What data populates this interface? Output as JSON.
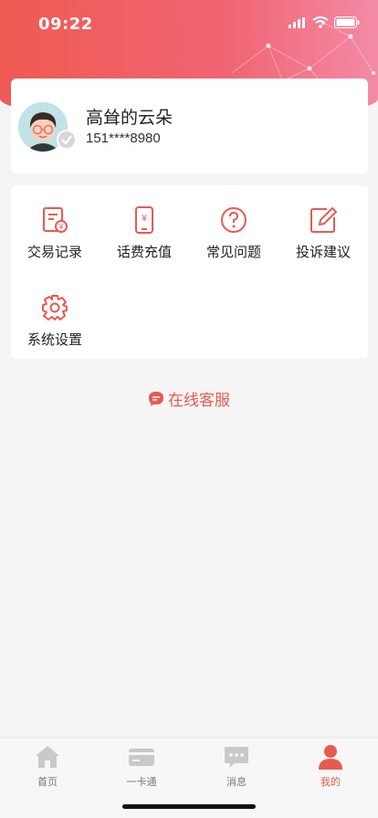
{
  "status": {
    "time": "09:22"
  },
  "profile": {
    "name": "高耸的云朵",
    "phone": "151****8980"
  },
  "menu": {
    "items": [
      {
        "label": "交易记录",
        "icon": "receipt-icon"
      },
      {
        "label": "话费充值",
        "icon": "phone-recharge-icon"
      },
      {
        "label": "常见问题",
        "icon": "question-icon"
      },
      {
        "label": "投诉建议",
        "icon": "edit-icon"
      },
      {
        "label": "系统设置",
        "icon": "gear-icon"
      }
    ]
  },
  "service": {
    "label": "在线客服"
  },
  "tabbar": {
    "tabs": [
      {
        "label": "首页",
        "icon": "home-icon"
      },
      {
        "label": "一卡通",
        "icon": "card-icon"
      },
      {
        "label": "消息",
        "icon": "message-icon"
      },
      {
        "label": "我的",
        "icon": "user-icon",
        "active": true
      }
    ]
  },
  "colors": {
    "accent": "#e85a50",
    "header_start": "#ef5a52",
    "header_end": "#f38aa6"
  }
}
